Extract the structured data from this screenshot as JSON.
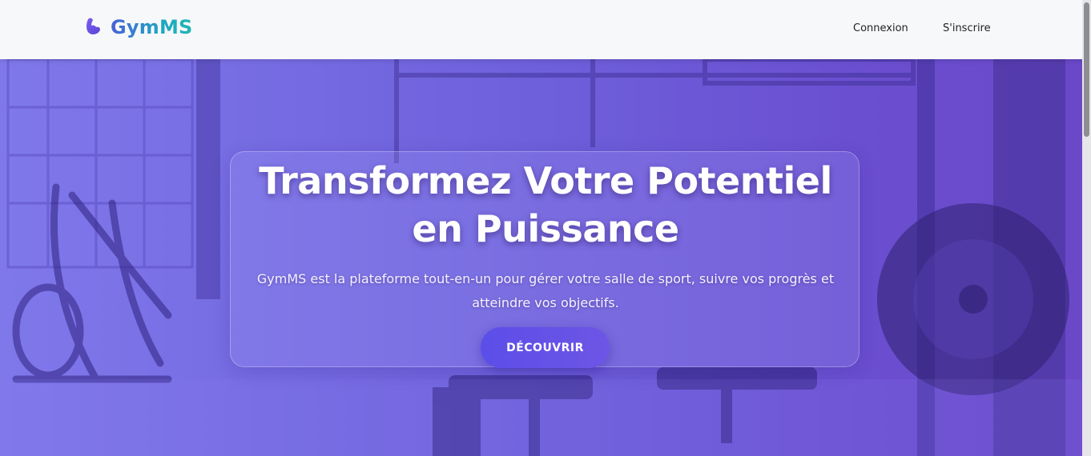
{
  "header": {
    "brand_name": "GymMS",
    "brand_icon": "flexed-bicep-icon",
    "nav": {
      "login_label": "Connexion",
      "register_label": "S'inscrire"
    }
  },
  "hero": {
    "title": "Transformez Votre Potentiel en Puissance",
    "subtitle": "GymMS est la plateforme tout-en-un pour gérer votre salle de sport, suivre vos progrès et atteindre vos objectifs.",
    "cta_label": "DÉCOUVRIR",
    "background": "gym-interior-photo"
  },
  "colors": {
    "brand_gradient_start": "#4a5fd8",
    "brand_gradient_end": "#20b8b0",
    "hero_overlay": "#6f62dc",
    "cta": "#5b4ee8"
  }
}
